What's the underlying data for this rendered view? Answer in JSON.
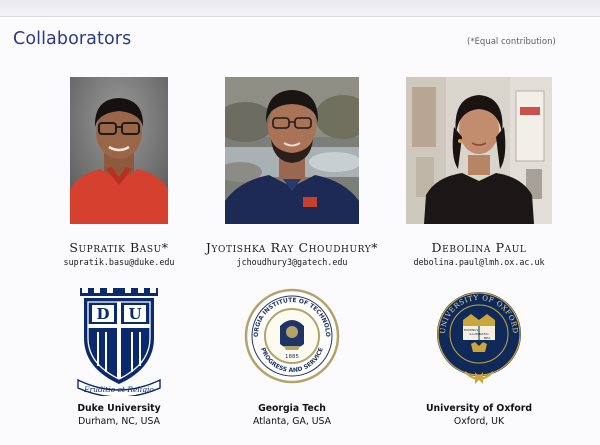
{
  "slide": {
    "title": "Collaborators",
    "note": "(*Equal contribution)"
  },
  "people": [
    {
      "name": "Supratik Basu*",
      "email": "supratik.basu@duke.edu",
      "university": "Duke University",
      "location": "Durham, NC, USA",
      "logo_motto": "Eruditio et Religio",
      "logo_letters": [
        "D",
        "U"
      ]
    },
    {
      "name": "Jyotishka Ray Choudhury*",
      "email": "jchoudhury3@gatech.edu",
      "university": "Georgia Tech",
      "location": "Atlanta, GA, USA",
      "logo_ring_top": "GEORGIA INSTITUTE OF TECHNOLOGY",
      "logo_ring_bottom": "PROGRESS AND SERVICE",
      "logo_year": "1885"
    },
    {
      "name": "Debolina Paul",
      "email": "debolina.paul@lmh.ox.ac.uk",
      "university": "University of Oxford",
      "location": "Oxford, UK",
      "logo_ring_text": "UNIVERSITY OF OXFORD",
      "logo_book_text": [
        "DOMINUS",
        "ILLUMINATIO",
        "MEA"
      ]
    }
  ],
  "colors": {
    "title": "#2c3a88",
    "duke_blue": "#0b2a6e",
    "gt_gold": "#b3a369",
    "gt_navy": "#1f3466",
    "oxford_blue": "#0f2a5a",
    "oxford_gold": "#c9a73c"
  }
}
